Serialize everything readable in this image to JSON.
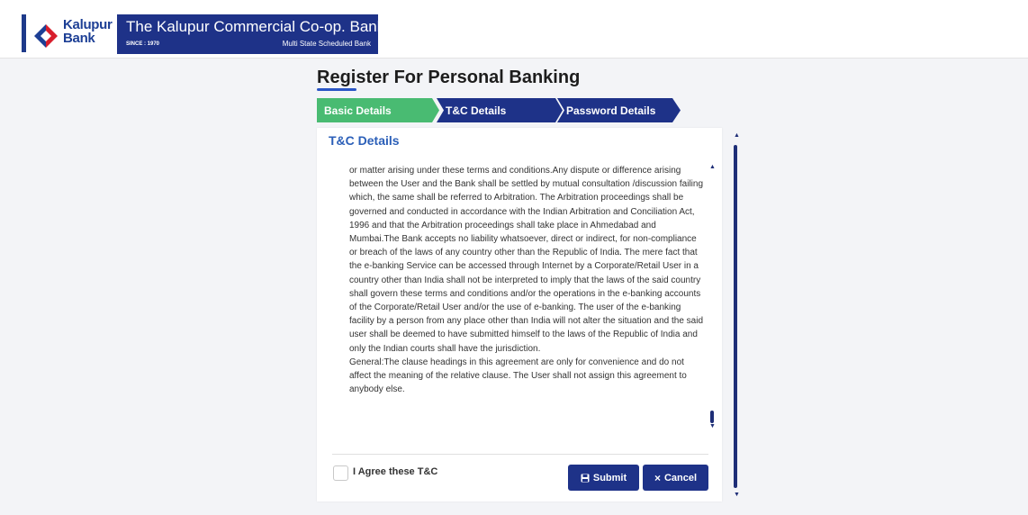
{
  "brand": {
    "logo_word1": "Kalupur",
    "logo_word2": "Bank",
    "bank_name": "The Kalupur Commercial Co-op. Bank Ltd.",
    "since": "SINCE : 1970",
    "subtitle": "Multi State Scheduled Bank"
  },
  "page": {
    "title": "Register For Personal Banking"
  },
  "steps": [
    {
      "label": "Basic Details",
      "color": "#49bb72",
      "state": "completed"
    },
    {
      "label": "T&C Details",
      "color": "#1e3288",
      "state": "current"
    },
    {
      "label": "Password Details",
      "color": "#1e3288",
      "state": "pending"
    }
  ],
  "card": {
    "title": "T&C Details",
    "terms_paragraph": "or matter arising under these terms and conditions.Any dispute or difference arising between the User and the Bank shall be settled by mutual consultation /discussion failing which, the same shall be referred to Arbitration. The Arbitration proceedings shall be governed and conducted in accordance with the Indian Arbitration and Conciliation Act, 1996 and that the Arbitration proceedings shall take place in Ahmedabad and Mumbai.The Bank accepts no liability whatsoever, direct or indirect, for non-compliance or breach of the laws of any country other than the Republic of India. The mere fact that the e-banking Service can be accessed through Internet by a Corporate/Retail User in a country other than India shall not be interpreted to imply that the laws of the said country shall govern these terms and conditions and/or the operations in the e-banking accounts of the Corporate/Retail User and/or the use of e-banking. The user of the e-banking facility by a person from any place other than India will not alter the situation and the said user shall be deemed to have submitted himself to the laws of the Republic of India and only the Indian courts shall have the jurisdiction.",
    "terms_bullet": "General:The clause headings in this agreement are only for convenience and do not affect the meaning of the relative clause. The User shall not assign this agreement to anybody else.",
    "agree_label": "I Agree these T&C",
    "submit_label": "Submit",
    "cancel_label": "Cancel"
  },
  "icons": {
    "submit": "save-icon",
    "cancel": "close-icon",
    "scroll_up": "scroll-up-icon",
    "scroll_down": "scroll-down-icon"
  },
  "colors": {
    "brand_navy": "#1e3288",
    "step_done": "#49bb72",
    "title_blue": "#2b5fb8"
  }
}
